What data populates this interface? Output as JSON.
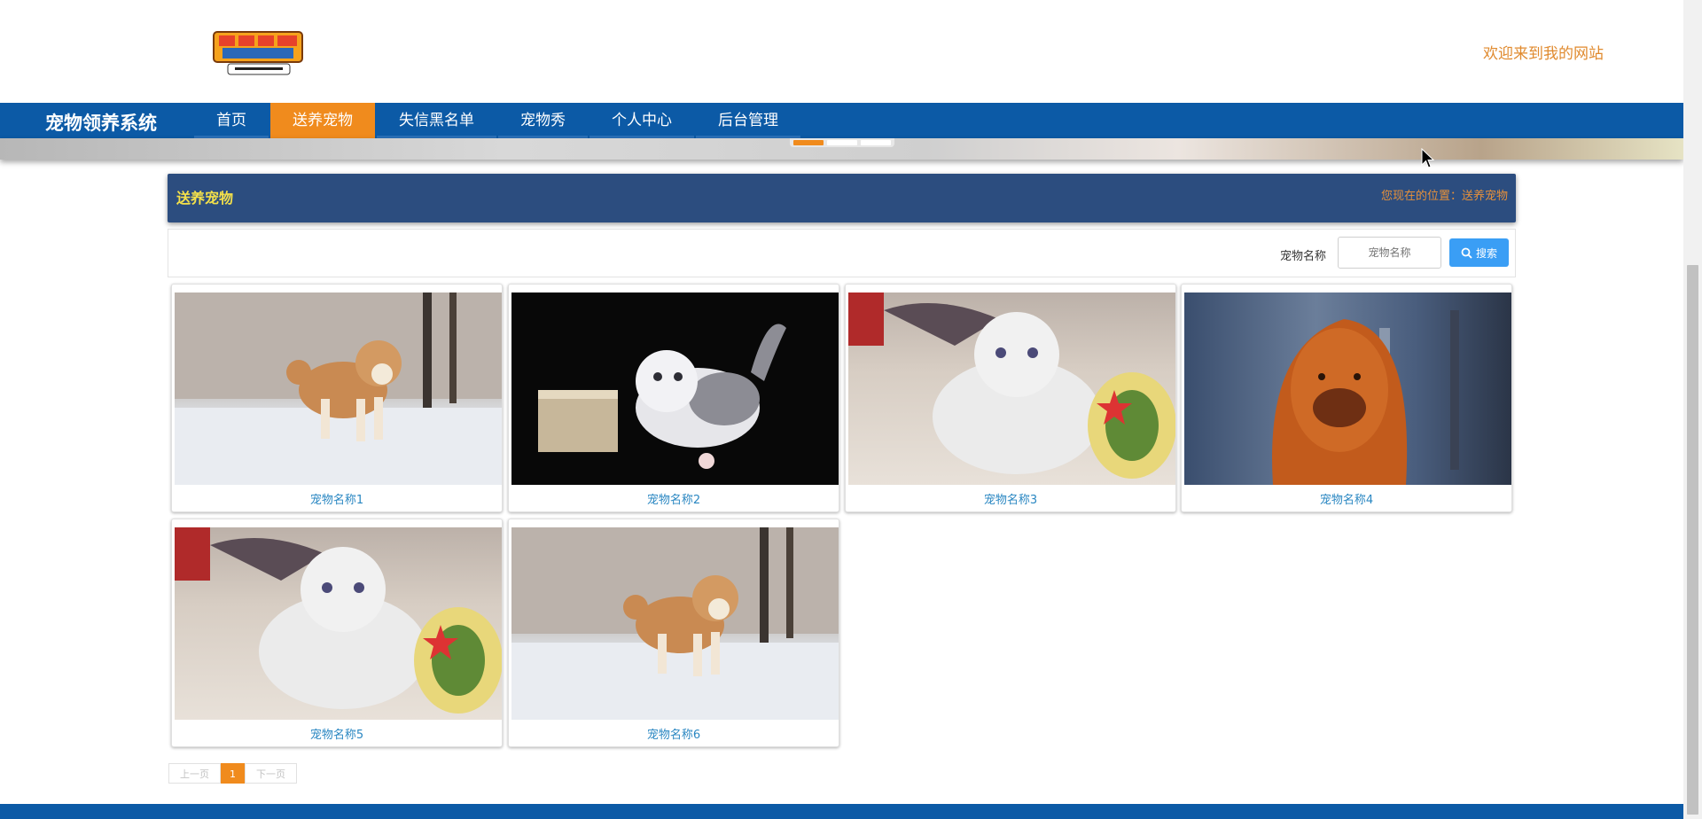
{
  "header": {
    "logo_alt": "BIGOYOS",
    "welcome": "欢迎来到我的网站"
  },
  "nav": {
    "brand": "宠物领养系统",
    "items": [
      {
        "label": "首页",
        "active": false
      },
      {
        "label": "送养宠物",
        "active": true
      },
      {
        "label": "失信黑名单",
        "active": false
      },
      {
        "label": "宠物秀",
        "active": false
      },
      {
        "label": "个人中心",
        "active": false
      },
      {
        "label": "后台管理",
        "active": false
      }
    ]
  },
  "panel": {
    "title": "送养宠物",
    "location": "您现在的位置：送养宠物"
  },
  "search": {
    "label": "宠物名称",
    "placeholder": "宠物名称",
    "button": "搜索"
  },
  "pets": [
    {
      "name": "宠物名称1",
      "image": "shiba-dog"
    },
    {
      "name": "宠物名称2",
      "image": "kitten-black-bg"
    },
    {
      "name": "宠物名称3",
      "image": "white-kitten-bed"
    },
    {
      "name": "宠物名称4",
      "image": "mastiff-dog"
    },
    {
      "name": "宠物名称5",
      "image": "white-kitten-bed"
    },
    {
      "name": "宠物名称6",
      "image": "shiba-dog"
    }
  ],
  "pagination": {
    "prev": "上一页",
    "current": "1",
    "next": "下一页"
  },
  "colors": {
    "nav": "#0c5aa6",
    "accent": "#f08b1d",
    "panel": "#2c4d7f",
    "search_button": "#3a9ef5"
  }
}
